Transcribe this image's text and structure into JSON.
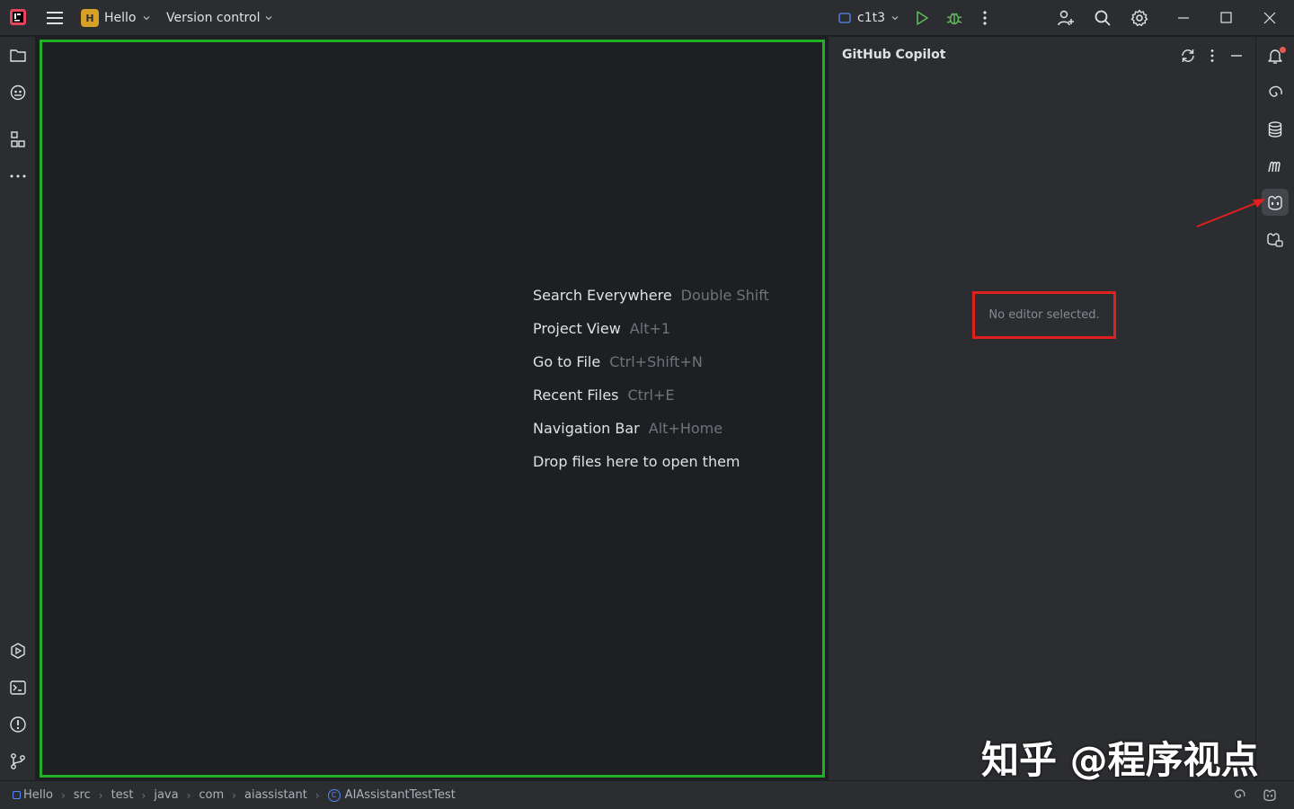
{
  "titlebar": {
    "project_badge": "H",
    "project_name": "Hello",
    "vcs_label": "Version control",
    "run_config": "c1t3"
  },
  "editor": {
    "hints": [
      {
        "action": "Search Everywhere",
        "shortcut": "Double Shift"
      },
      {
        "action": "Project View",
        "shortcut": "Alt+1"
      },
      {
        "action": "Go to File",
        "shortcut": "Ctrl+Shift+N"
      },
      {
        "action": "Recent Files",
        "shortcut": "Ctrl+E"
      },
      {
        "action": "Navigation Bar",
        "shortcut": "Alt+Home"
      },
      {
        "action": "Drop files here to open them",
        "shortcut": ""
      }
    ]
  },
  "copilot_panel": {
    "title": "GitHub Copilot",
    "empty_message": "No editor selected."
  },
  "statusbar": {
    "breadcrumbs": [
      "Hello",
      "src",
      "test",
      "java",
      "com",
      "aiassistant",
      "AIAssistantTestTest"
    ]
  },
  "watermark": "知乎 @程序视点",
  "colors": {
    "highlight_green": "#22b024",
    "highlight_red": "#e0201c",
    "accent_blue": "#548af7",
    "run_green": "#5fb85a"
  }
}
